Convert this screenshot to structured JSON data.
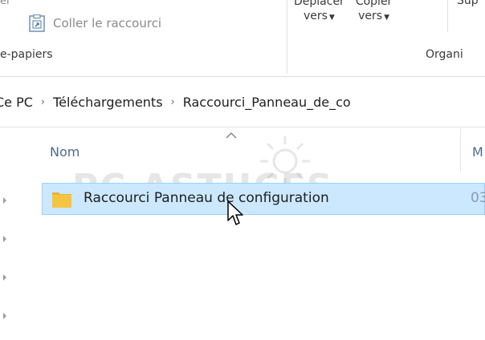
{
  "ribbon": {
    "top_left_fragment": "er",
    "paste_shortcut_label": "Coller le raccourci",
    "clipboard_group": "e-papiers",
    "move_to": {
      "top": "Déplacer",
      "bottom": "vers"
    },
    "copy_to": {
      "top": "Copier",
      "bottom": "vers"
    },
    "delete_fragment": "Sup",
    "organize_group": "Organi"
  },
  "breadcrumb": {
    "items": [
      "Ce PC",
      "Téléchargements",
      "Raccourci_Panneau_de_co"
    ]
  },
  "file_list": {
    "columns": [
      "Nom",
      "M"
    ],
    "rows": [
      {
        "name": "Raccourci Panneau de configuration",
        "date": "03"
      }
    ]
  },
  "watermark": {
    "text": "PC ASTUCES"
  },
  "colors": {
    "selection_bg": "#cce8ff",
    "selection_border": "#99d1ff",
    "folder": "#f5c542"
  }
}
